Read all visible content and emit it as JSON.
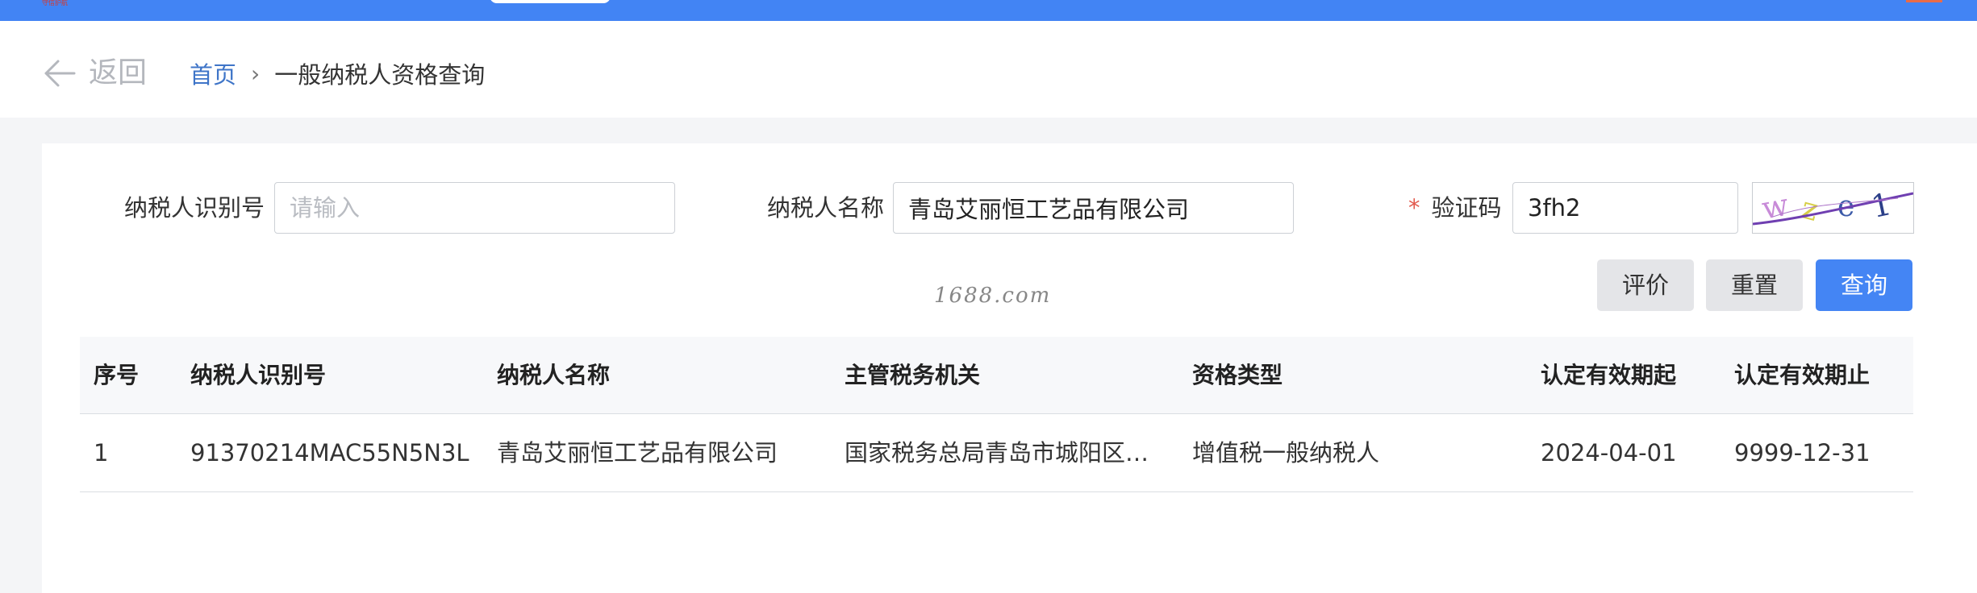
{
  "topbar": {
    "color": "#4284f4",
    "logo_fragment": "守信护航"
  },
  "header": {
    "back_label": "返回",
    "breadcrumb": {
      "home": "首页",
      "separator": "›",
      "current": "一般纳税人资格查询"
    }
  },
  "form": {
    "taxpayer_id": {
      "label": "纳税人识别号",
      "placeholder": "请输入",
      "value": ""
    },
    "taxpayer_name": {
      "label": "纳税人名称",
      "value": "青岛艾丽恒工艺品有限公司"
    },
    "captcha": {
      "required_mark": "*",
      "label": "验证码",
      "value": "3fh2",
      "image_text": "wze1"
    }
  },
  "buttons": {
    "evaluate": "评价",
    "reset": "重置",
    "query": "查询"
  },
  "watermark": "1688.com",
  "table": {
    "columns": [
      "序号",
      "纳税人识别号",
      "纳税人名称",
      "主管税务机关",
      "资格类型",
      "认定有效期起",
      "认定有效期止"
    ],
    "rows": [
      [
        "1",
        "91370214MAC55N5N3L",
        "青岛艾丽恒工艺品有限公司",
        "国家税务总局青岛市城阳区税...",
        "增值税一般纳税人",
        "2024-04-01",
        "9999-12-31"
      ]
    ]
  },
  "colors": {
    "accent": "#4485f4",
    "link": "#3f75c8",
    "required": "#e25b4f"
  }
}
